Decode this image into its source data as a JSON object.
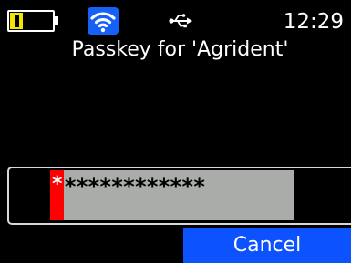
{
  "status_bar": {
    "battery_icon": "battery-icon",
    "battery_level": 0.3,
    "wifi_icon": "wifi-icon",
    "usb_icon": "usb-icon",
    "time": "12:29"
  },
  "dialog": {
    "title": "Passkey for 'Agrident'",
    "passkey_value": "************",
    "cursor_char": "*"
  },
  "buttons": {
    "cancel_label": "Cancel"
  },
  "colors": {
    "background": "#000000",
    "battery": "#f2e600",
    "wifi_bg": "#1560f5",
    "input_field": "#a9aca9",
    "cursor": "#ff0000",
    "cancel_button": "#0d52ff"
  }
}
